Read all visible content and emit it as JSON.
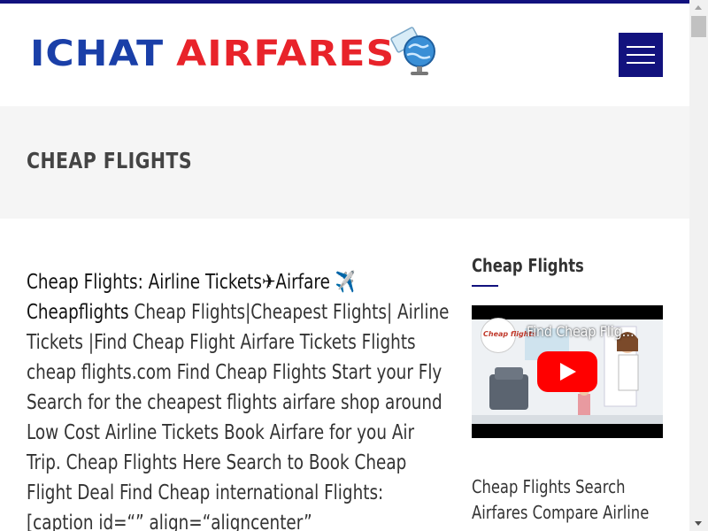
{
  "brand": {
    "word1": "ICHAT",
    "word2": "AIRFARES",
    "colors": {
      "blue": "#1a3fa8",
      "red": "#e8232a",
      "nav": "#12127e"
    }
  },
  "header": {
    "menu_icon": "hamburger-menu-icon"
  },
  "banner": {
    "title": "CHEAP FLIGHTS"
  },
  "article": {
    "lead": "Cheap Flights: Airline Tickets✈Airfare ✈️ Cheapflights",
    "body": " Cheap Flights|Cheapest Flights| Airline Tickets |Find Cheap Flight Airfare Tickets Flights cheap flights.com Find Cheap Flights Start your Fly Search for the cheapest flights airfare shop around Low Cost Airline Tickets Book Airfare for you Air Trip. Cheap Flights Here Search to Book Cheap Flight Deal Find Cheap international Flights: [caption id=“” align=“aligncenter”"
  },
  "sidebar": {
    "widget1_title": "Cheap Flights",
    "video": {
      "title": "Find Cheap Flig…",
      "channel": "Cheap flights",
      "play_icon": "play-icon"
    },
    "widget2_text": "Cheap Flights Search Airfares Compare Airline"
  }
}
